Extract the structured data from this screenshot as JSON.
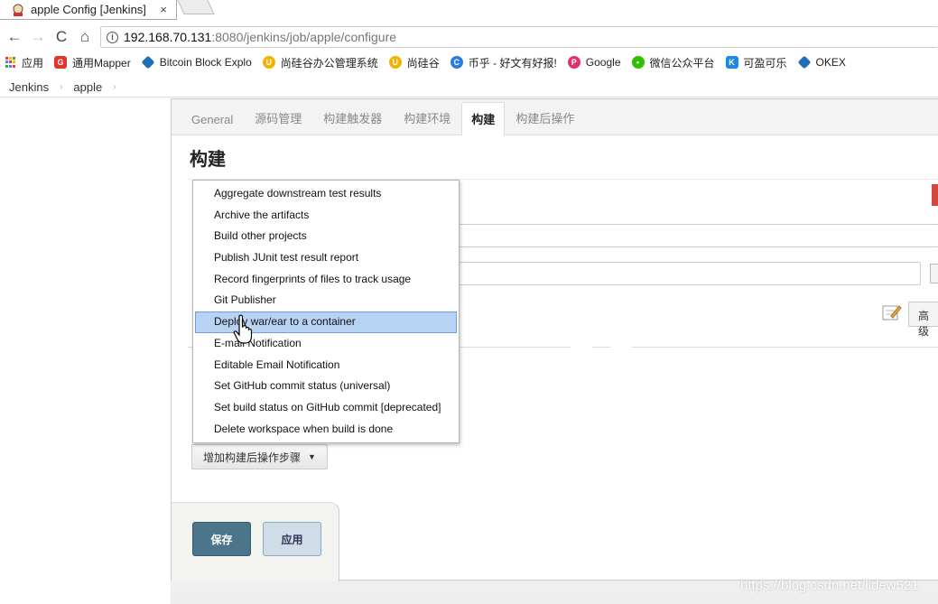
{
  "browser": {
    "tab_title": "apple Config [Jenkins]",
    "tab_close": "×",
    "url_host": "192.168.70.131",
    "url_rest": ":8080/jenkins/job/apple/configure"
  },
  "bookmarks": [
    {
      "label": "应用",
      "icon": "apps-grid-icon"
    },
    {
      "label": "通用Mapper",
      "icon": "g-icon",
      "color": "#e5322d"
    },
    {
      "label": "Bitcoin Block Explo",
      "icon": "diamond-icon",
      "color": "#1d6fb8"
    },
    {
      "label": "尚硅谷办公管理系统",
      "icon": "u-icon",
      "color": "#f0b400"
    },
    {
      "label": "尚硅谷",
      "icon": "u-icon",
      "color": "#f0b400"
    },
    {
      "label": "币乎 - 好文有好报!",
      "icon": "c-icon",
      "color": "#2a7de1"
    },
    {
      "label": "Google",
      "icon": "p-icon",
      "color": "#e1306c"
    },
    {
      "label": "微信公众平台",
      "icon": "wechat-icon",
      "color": "#2dc100"
    },
    {
      "label": "可盈可乐",
      "icon": "k-icon",
      "color": "#1e88e5"
    },
    {
      "label": "OKEX",
      "icon": "diamond-icon",
      "color": "#1d6fb8"
    }
  ],
  "breadcrumb": {
    "root": "Jenkins",
    "job": "apple"
  },
  "config_tabs": [
    {
      "label": "General",
      "active": false
    },
    {
      "label": "源码管理",
      "active": false
    },
    {
      "label": "构建触发器",
      "active": false
    },
    {
      "label": "构建环境",
      "active": false
    },
    {
      "label": "构建",
      "active": true
    },
    {
      "label": "构建后操作",
      "active": false
    }
  ],
  "section_title": "构建",
  "advanced_label": "高级",
  "add_post_build_label": "增加构建后操作步骤",
  "save_label": "保存",
  "apply_label": "应用",
  "dropdown_items": [
    "Aggregate downstream test results",
    "Archive the artifacts",
    "Build other projects",
    "Publish JUnit test result report",
    "Record fingerprints of files to track usage",
    "Git Publisher",
    "Deploy war/ear to a container",
    "E-mail Notification",
    "Editable Email Notification",
    "Set GitHub commit status (universal)",
    "Set build status on GitHub commit [deprecated]",
    "Delete workspace when build is done"
  ],
  "dropdown_hover_index": 6,
  "watermark": "https://blog.csdn.net/lidew521"
}
